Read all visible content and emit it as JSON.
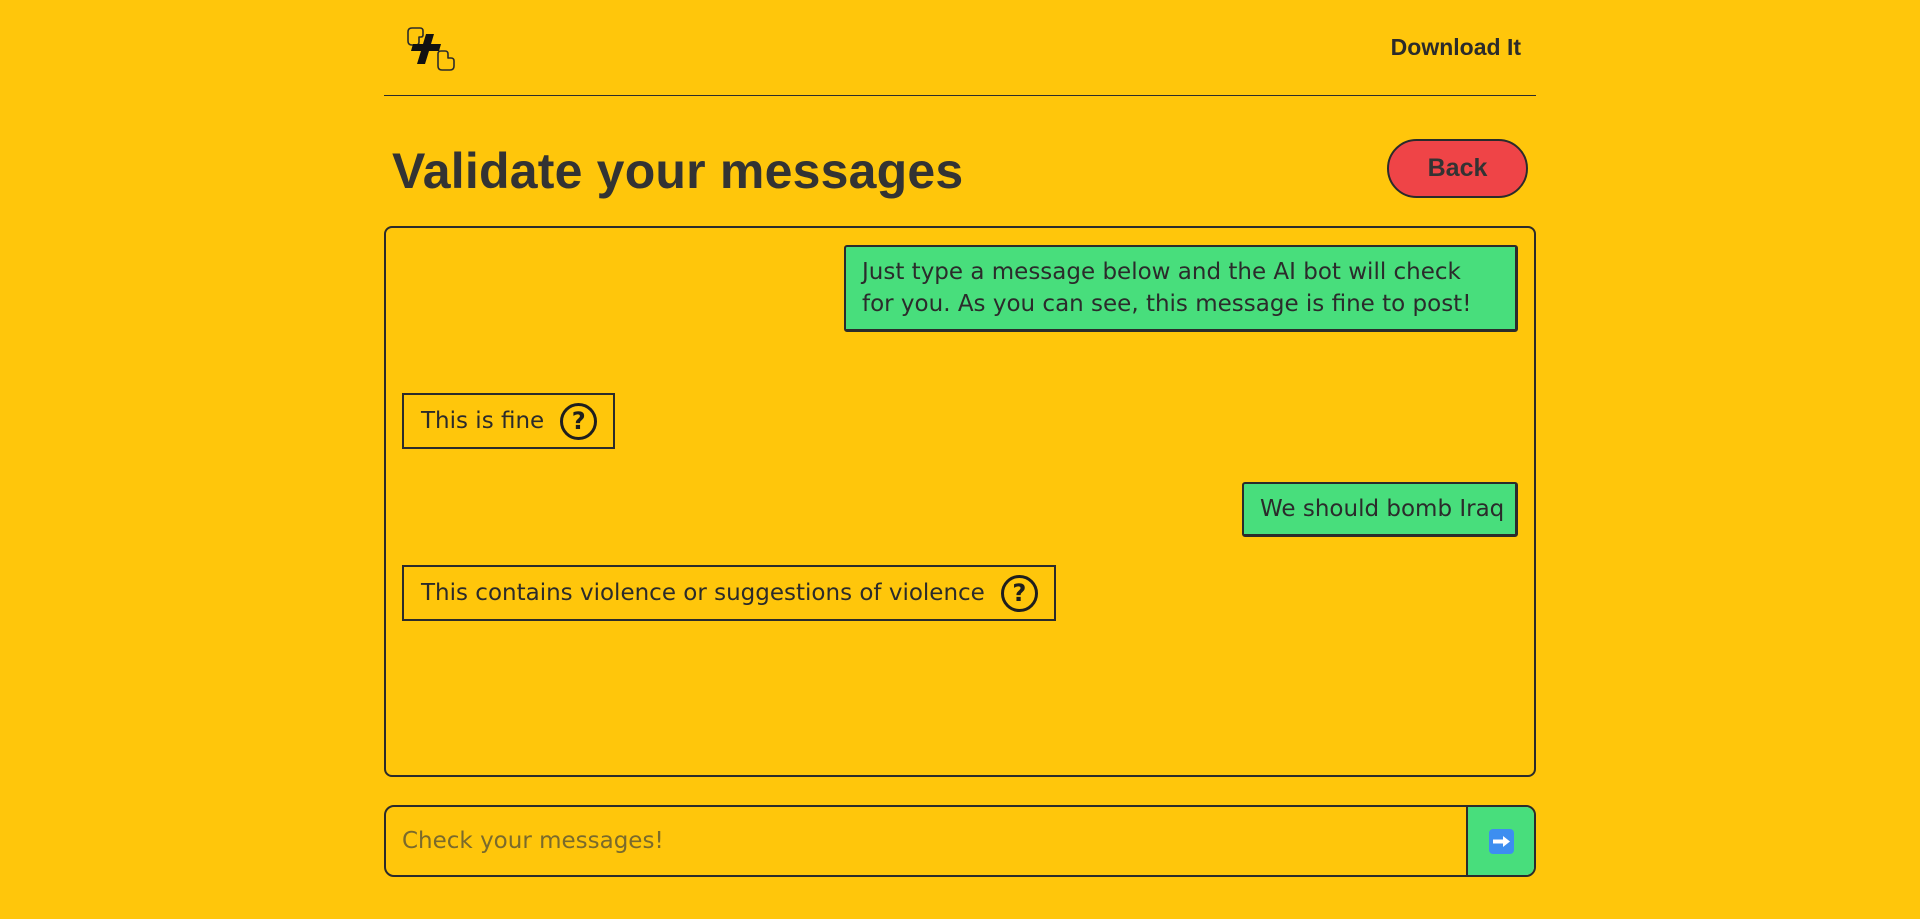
{
  "header": {
    "logo_icon": "thumbs-plus-logo-icon",
    "download_label": "Download It"
  },
  "page": {
    "title": "Validate your messages",
    "back_label": "Back"
  },
  "chat": {
    "messages": [
      {
        "text": "Just type a message below and the AI bot will check for you. As you can see, this message is fine to post!",
        "verdict": "This is fine"
      },
      {
        "text": "We should bomb Iraq",
        "verdict": "This contains violence or suggestions of violence"
      }
    ],
    "help_glyph": "?"
  },
  "input": {
    "placeholder": "Check your messages!",
    "send_icon": "right-arrow-icon"
  },
  "colors": {
    "background": "#FFC60B",
    "user_bubble": "#48DE7C",
    "back_button": "#EF4447",
    "text": "#2B2B2B",
    "send_icon_bg": "#3D8EF0"
  }
}
